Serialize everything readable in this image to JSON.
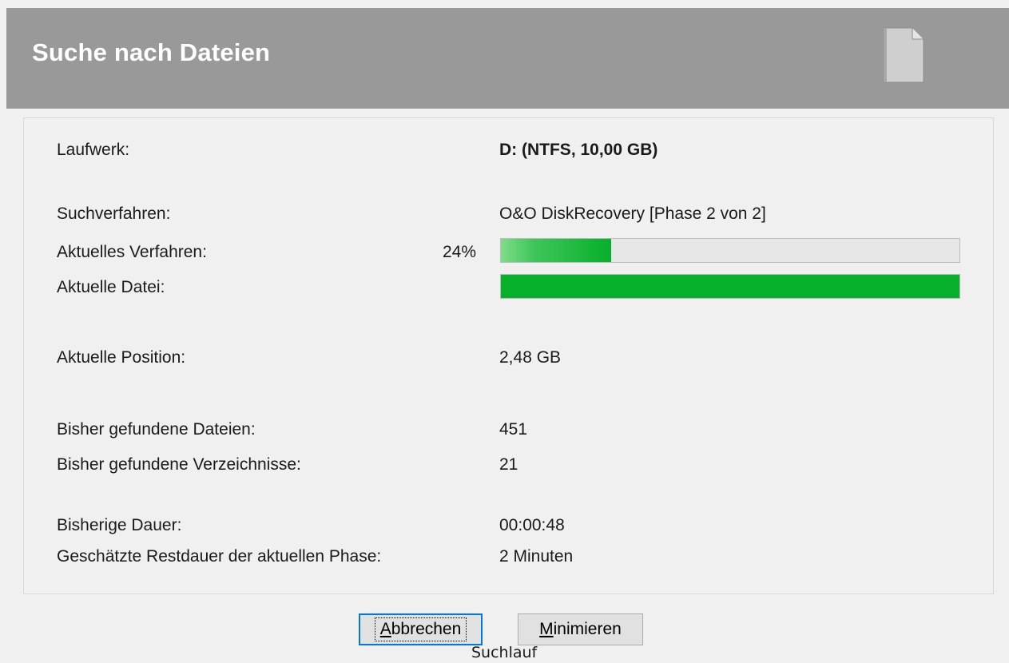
{
  "window": {
    "title": "Suche nach Dateien",
    "icon": "document-icon"
  },
  "rows": {
    "drive": {
      "label": "Laufwerk:",
      "value": "D: (NTFS, 10,00 GB)"
    },
    "method": {
      "label": "Suchverfahren:",
      "value": "O&O DiskRecovery [Phase 2 von 2]"
    },
    "current_method": {
      "label": "Aktuelles Verfahren:",
      "percent": "24%",
      "progress": 0.24
    },
    "current_file": {
      "label": "Aktuelle Datei:",
      "progress": 1.0
    },
    "current_position": {
      "label": "Aktuelle Position:",
      "value": "2,48 GB"
    },
    "files_found": {
      "label": "Bisher gefundene Dateien:",
      "value": "451"
    },
    "dirs_found": {
      "label": "Bisher gefundene Verzeichnisse:",
      "value": "21"
    },
    "elapsed": {
      "label": "Bisherige Dauer:",
      "value": "00:00:48"
    },
    "remaining": {
      "label": "Geschätzte Restdauer der aktuellen Phase:",
      "value": "2 Minuten"
    }
  },
  "buttons": {
    "cancel": {
      "label_access": "A",
      "label_rest": "bbrechen"
    },
    "minimize": {
      "label_access": "M",
      "label_rest": "inimieren"
    }
  },
  "status": "Suchlauf",
  "colors": {
    "header_bg": "#999999",
    "progress_green": "#06b02b",
    "focus_border": "#0078d7"
  }
}
